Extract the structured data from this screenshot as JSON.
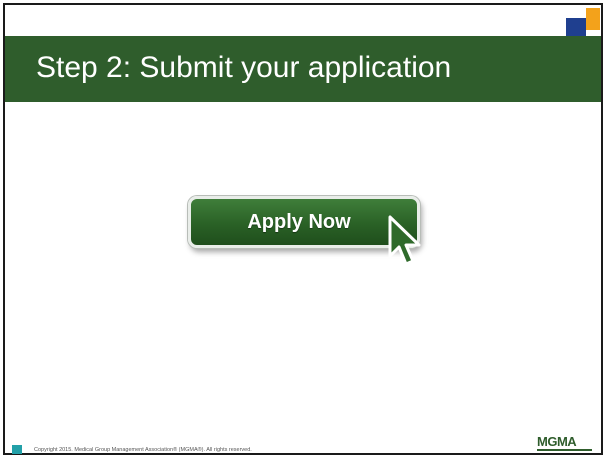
{
  "slide": {
    "title": "Step 2: Submit your application"
  },
  "button": {
    "label": "Apply Now"
  },
  "footer": {
    "copyright": "Copyright 2015. Medical Group Management Association® (MGMA®). All rights reserved."
  },
  "logo": {
    "text": "MGMA"
  },
  "colors": {
    "title_bar": "#2f5d2c",
    "button_green": "#2a6126",
    "corner_blue": "#1f3f8f",
    "corner_orange": "#f3a21b",
    "footer_square": "#22a0a8"
  },
  "icons": {
    "cursor": "arrow-cursor-icon"
  }
}
